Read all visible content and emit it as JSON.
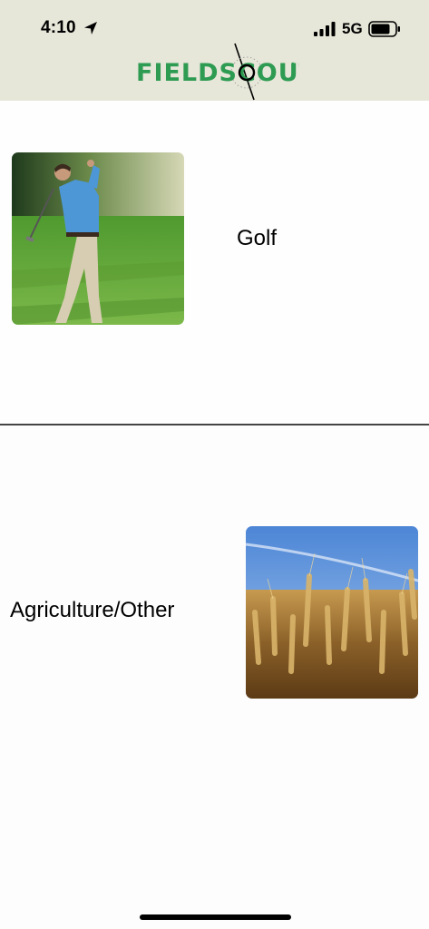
{
  "status_bar": {
    "time": "4:10",
    "network": "5G",
    "location_icon": "location-arrow-icon",
    "signal_icon": "cellular-signal-icon",
    "battery_icon": "battery-icon"
  },
  "header": {
    "logo_text": "FIELDSCOUT",
    "logo_color": "#2e9b52",
    "background": "#e6e6d9"
  },
  "options": [
    {
      "label": "Golf",
      "image": "golfer-photo"
    },
    {
      "label": "Agriculture/Other",
      "image": "wheat-field-photo"
    }
  ]
}
